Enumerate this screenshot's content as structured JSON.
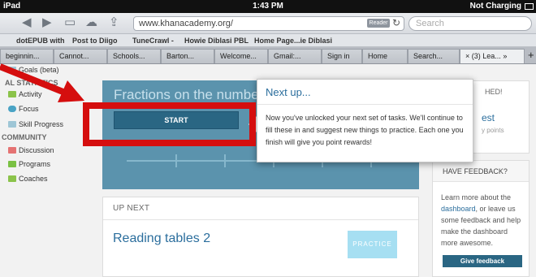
{
  "status_bar": {
    "device": "iPad",
    "time": "1:43 PM",
    "charging": "Not Charging"
  },
  "browser": {
    "url": "www.khanacademy.org/",
    "reader_label": "Reader",
    "search_placeholder": "Search",
    "bookmarks": [
      "dotEPUB with",
      "Post to Diigo",
      "TuneCrawl -",
      "Howie Diblasi PBL",
      "Home Page...ie Diblasi"
    ],
    "tabs": [
      "beginnin...",
      "Cannot...",
      "Schools...",
      "Barton...",
      "Welcome...",
      "Gmail:...",
      "Sign in",
      "Home",
      "Search...",
      "(3) Lea..."
    ],
    "tab_overflow": "»",
    "new_tab": "+"
  },
  "sidebar": {
    "items_top": [
      {
        "label": "Goals (beta)",
        "icon": "goals-icon",
        "color": "#9ec6d6"
      },
      {
        "label": "Activity",
        "icon": "activity-icon",
        "color": "#8bc34a"
      },
      {
        "label": "Focus",
        "icon": "focus-icon",
        "color": "#4aa3c5"
      },
      {
        "label": "Skill Progress",
        "icon": "skill-progress-icon",
        "color": "#9ec6d6"
      }
    ],
    "stats_heading": "AL STATISTICS",
    "community_heading": "COMMUNITY",
    "community_items": [
      {
        "label": "Discussion",
        "icon": "discussion-icon",
        "color": "#e57373"
      },
      {
        "label": "Programs",
        "icon": "programs-icon",
        "color": "#7ac143"
      },
      {
        "label": "Coaches",
        "icon": "coaches-icon",
        "color": "#8bc34a"
      }
    ]
  },
  "mission": {
    "title": "Fractions on the number",
    "start_label": "START"
  },
  "up_next": {
    "label": "UP NEXT",
    "title": "Reading tables 2",
    "practice_label": "PRACTICE"
  },
  "right_panel": {
    "heading_fragment": "HED!",
    "link_fragment": "est",
    "points_fragment": "y points"
  },
  "feedback": {
    "heading": "HAVE FEEDBACK?",
    "body_prefix": "Learn more about the ",
    "link_text": "dashboard",
    "body_suffix": ", or leave us some feedback and help make the dashboard more awesome.",
    "button_label": "Give feedback"
  },
  "popover": {
    "title": "Next up...",
    "body": "Now you've unlocked your next set of tasks. We'll continue to fill these in and suggest new things to practice. Each one you finish will give you point rewards!"
  },
  "colors": {
    "annotation_red": "#d50e0e",
    "mission_blue": "#5b93ad",
    "button_blue": "#2a6683",
    "link_blue": "#2b6e9d"
  }
}
